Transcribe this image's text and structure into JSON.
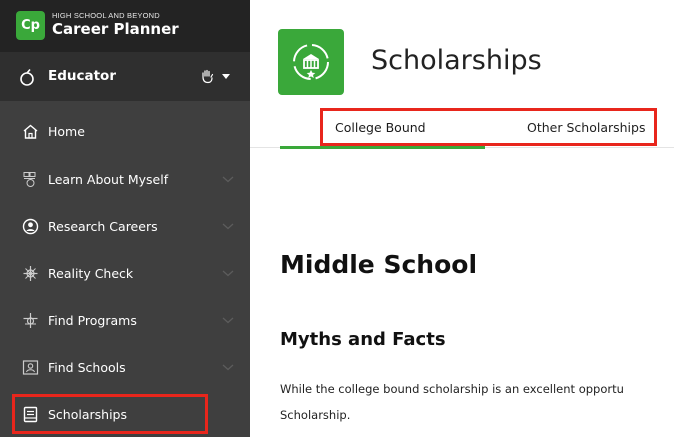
{
  "brand": {
    "logo_text": "Cp",
    "subtitle": "HIGH SCHOOL AND BEYOND",
    "title": "Career Planner"
  },
  "role": {
    "label": "Educator"
  },
  "nav": {
    "items": [
      {
        "label": "Home",
        "icon": "home-icon",
        "has_chevron": false
      },
      {
        "label": "Learn About Myself",
        "icon": "assessment-icon",
        "has_chevron": true
      },
      {
        "label": "Research Careers",
        "icon": "person-circle-icon",
        "has_chevron": true
      },
      {
        "label": "Reality Check",
        "icon": "budget-icon",
        "has_chevron": true
      },
      {
        "label": "Find Programs",
        "icon": "programs-icon",
        "has_chevron": true
      },
      {
        "label": "Find Schools",
        "icon": "school-icon",
        "has_chevron": true
      },
      {
        "label": "Scholarships",
        "icon": "scholarship-icon",
        "has_chevron": false
      }
    ]
  },
  "header": {
    "title": "Scholarships",
    "icon": "scholarship-badge-icon"
  },
  "tabs": [
    {
      "label": "College Bound",
      "active": true
    },
    {
      "label": "Other Scholarships",
      "active": false
    }
  ],
  "content": {
    "heading": "Middle School",
    "subheading": "Myths and Facts",
    "paragraph_line1": "While the college bound scholarship is an excellent opportu",
    "paragraph_line2": "Scholarship."
  },
  "colors": {
    "accent_green": "#3aa83a",
    "highlight_red": "#e8261c",
    "sidebar_bg": "#3f3f3f",
    "sidebar_header_bg": "#232323"
  }
}
